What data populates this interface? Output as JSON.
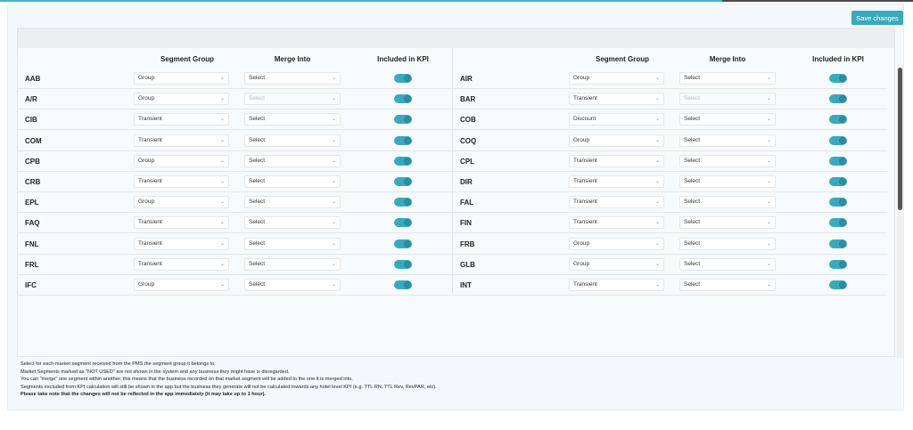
{
  "toolbar": {
    "save_label": "Save changes"
  },
  "headers": {
    "segment_group": "Segment Group",
    "merge_into": "Merge Into",
    "included_kpi": "Included in KPI"
  },
  "left_rows": [
    {
      "code": "AAB",
      "group": "Group",
      "merge": "Select",
      "merge_disabled": false,
      "kpi": true
    },
    {
      "code": "A/R",
      "group": "Group",
      "merge": "Select",
      "merge_disabled": true,
      "kpi": true
    },
    {
      "code": "CIB",
      "group": "Transient",
      "merge": "Select",
      "merge_disabled": false,
      "kpi": true
    },
    {
      "code": "COM",
      "group": "Transient",
      "merge": "Select",
      "merge_disabled": false,
      "kpi": true
    },
    {
      "code": "CPB",
      "group": "Group",
      "merge": "Select",
      "merge_disabled": false,
      "kpi": true
    },
    {
      "code": "CRB",
      "group": "Transient",
      "merge": "Select",
      "merge_disabled": false,
      "kpi": true
    },
    {
      "code": "EPL",
      "group": "Group",
      "merge": "Select",
      "merge_disabled": false,
      "kpi": true
    },
    {
      "code": "FAQ",
      "group": "Transient",
      "merge": "Select",
      "merge_disabled": false,
      "kpi": true
    },
    {
      "code": "FNL",
      "group": "Transient",
      "merge": "Select",
      "merge_disabled": false,
      "kpi": true
    },
    {
      "code": "FRL",
      "group": "Transient",
      "merge": "Select",
      "merge_disabled": false,
      "kpi": true
    },
    {
      "code": "IFC",
      "group": "Group",
      "merge": "Select",
      "merge_disabled": false,
      "kpi": true
    }
  ],
  "right_rows": [
    {
      "code": "AIR",
      "group": "Group",
      "merge": "Select",
      "merge_disabled": false,
      "kpi": true
    },
    {
      "code": "BAR",
      "group": "Transient",
      "merge": "Select",
      "merge_disabled": true,
      "kpi": true
    },
    {
      "code": "COB",
      "group": "Discount",
      "merge": "Select",
      "merge_disabled": false,
      "kpi": true
    },
    {
      "code": "COQ",
      "group": "Group",
      "merge": "Select",
      "merge_disabled": false,
      "kpi": true
    },
    {
      "code": "CPL",
      "group": "Transient",
      "merge": "Select",
      "merge_disabled": false,
      "kpi": true
    },
    {
      "code": "DIR",
      "group": "Transient",
      "merge": "Select",
      "merge_disabled": false,
      "kpi": true
    },
    {
      "code": "FAL",
      "group": "Transient",
      "merge": "Select",
      "merge_disabled": false,
      "kpi": true
    },
    {
      "code": "FIN",
      "group": "Transient",
      "merge": "Select",
      "merge_disabled": false,
      "kpi": true
    },
    {
      "code": "FRB",
      "group": "Group",
      "merge": "Select",
      "merge_disabled": false,
      "kpi": true
    },
    {
      "code": "GLB",
      "group": "Group",
      "merge": "Select",
      "merge_disabled": false,
      "kpi": true
    },
    {
      "code": "INT",
      "group": "Transient",
      "merge": "Select",
      "merge_disabled": false,
      "kpi": true
    }
  ],
  "notes": {
    "line1": "Select for each market segment received from the PMS the segment group it belongs to.",
    "line2": "Market Segments marked as \"NOT USED\" are not shown in the system and any business they might have is disregarded.",
    "line3": "You can \"merge\" one segment within another; this means that the business recorded on that market segment will be added to the one it is merged into.",
    "line4": "Segments excluded from KPI calculation will still be shown in the app but the business they generate will not be calculated towards any hotel level KPI (e.g. TTL RN, TTL Rev, RevPAR, etc).",
    "line5": "Please take note that the changes will not be reflected in the app immediately (it may take up to 1 hour)."
  },
  "colors": {
    "accent": "#3aa9bd",
    "background": "#f5f8fa"
  }
}
